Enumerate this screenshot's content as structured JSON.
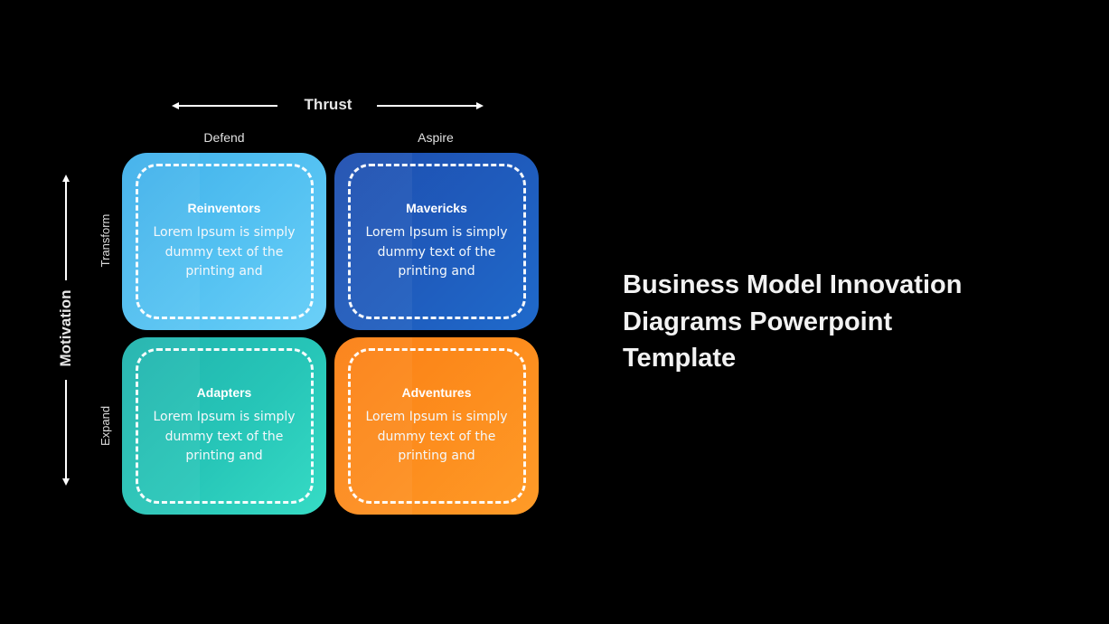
{
  "slide": {
    "title_lines": [
      "Business Model Innovation",
      "Diagrams Powerpoint",
      "Template"
    ],
    "background_color": "#000000"
  },
  "axes": {
    "horizontal": {
      "title": "Thrust",
      "left_label": "Defend",
      "right_label": "Aspire"
    },
    "vertical": {
      "title": "Motivation",
      "top_label": "Transform",
      "bottom_label": "Expand"
    }
  },
  "quadrants": [
    {
      "title": "Reinventors",
      "body": "Lorem Ipsum is simply dummy text of the printing and",
      "color": "#55c2f2",
      "position": "top-left"
    },
    {
      "title": "Mavericks",
      "body": "Lorem Ipsum is simply dummy text of the printing and",
      "color": "#1f5cbd",
      "position": "top-right"
    },
    {
      "title": "Adapters",
      "body": "Lorem Ipsum is simply dummy text of the printing and",
      "color": "#27c6b8",
      "position": "bottom-left"
    },
    {
      "title": "Adventures",
      "body": "Lorem Ipsum is simply dummy text of the printing and",
      "color": "#fd8e1e",
      "position": "bottom-right"
    }
  ]
}
